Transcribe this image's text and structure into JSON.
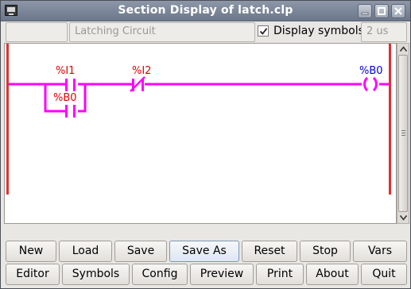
{
  "window": {
    "title": "Section Display of latch.clp"
  },
  "header": {
    "left_field_value": "",
    "section_name": "Latching Circuit",
    "display_symbols_label": "Display symbols",
    "display_symbols_checked": true,
    "cycle_time": "2 us"
  },
  "ladder": {
    "rail_color": "#e03030",
    "wire_color": "#ff00ff",
    "contact_1_label": "%I1",
    "contact_parallel_label": "%B0",
    "contact_2_label": "%I2",
    "coil_label": "%B0"
  },
  "buttons_row1": {
    "new": "New",
    "load": "Load",
    "save": "Save",
    "save_as": "Save As",
    "reset": "Reset",
    "stop": "Stop",
    "vars": "Vars"
  },
  "buttons_row2": {
    "editor": "Editor",
    "symbols": "Symbols",
    "config": "Config",
    "preview": "Preview",
    "print": "Print",
    "about": "About",
    "quit": "Quit"
  }
}
